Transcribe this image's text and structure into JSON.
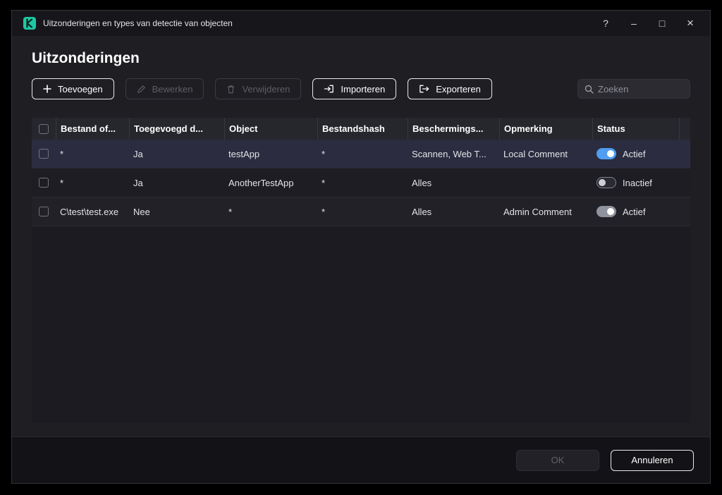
{
  "window": {
    "title": "Uitzonderingen en types van detectie van objecten",
    "controls": {
      "help": "?",
      "minimize": "–",
      "maximize": "□",
      "close": "×"
    }
  },
  "page": {
    "title": "Uitzonderingen"
  },
  "toolbar": {
    "add": "Toevoegen",
    "edit": "Bewerken",
    "remove": "Verwijderen",
    "import": "Importeren",
    "export": "Exporteren",
    "search_placeholder": "Zoeken"
  },
  "table": {
    "columns": [
      "Bestand of...",
      "Toegevoegd d...",
      "Object",
      "Bestandshash",
      "Beschermings...",
      "Opmerking",
      "Status"
    ],
    "rows": [
      {
        "file": "*",
        "added": "Ja",
        "object": "testApp",
        "hash": "*",
        "protection": "Scannen, Web T...",
        "comment": "Local Comment",
        "status_label": "Actief",
        "toggle": "on",
        "row_state": "selected"
      },
      {
        "file": "*",
        "added": "Ja",
        "object": "AnotherTestApp",
        "hash": "*",
        "protection": "Alles",
        "comment": "",
        "status_label": "Inactief",
        "toggle": "off",
        "row_state": ""
      },
      {
        "file": "C\\test\\test.exe",
        "added": "Nee",
        "object": "*",
        "hash": "*",
        "protection": "Alles",
        "comment": "Admin Comment",
        "status_label": "Actief",
        "toggle": "muted",
        "row_state": ""
      }
    ]
  },
  "footer": {
    "ok": "OK",
    "cancel": "Annuleren"
  },
  "colors": {
    "accent_blue": "#4f9ef0",
    "brand_green": "#1ec8a5"
  }
}
